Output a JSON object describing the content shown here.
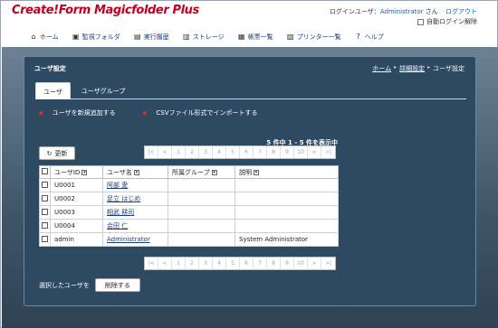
{
  "app": {
    "logo": "Create!Form Magicfolder Plus"
  },
  "login": {
    "label": "ログインユーザ：",
    "user": "Administrator",
    "suffix": "さん",
    "logout": "ログアウト",
    "auto_login": "自動ログイン解除"
  },
  "nav": [
    {
      "label": "ホーム",
      "icon": "home-icon"
    },
    {
      "label": "監視フォルダ",
      "icon": "folder-icon"
    },
    {
      "label": "実行履歴",
      "icon": "history-icon"
    },
    {
      "label": "ストレージ",
      "icon": "storage-icon"
    },
    {
      "label": "帳票一覧",
      "icon": "document-list-icon"
    },
    {
      "label": "プリンター一覧",
      "icon": "printer-icon"
    },
    {
      "label": "ヘルプ",
      "icon": "help-icon"
    }
  ],
  "panel": {
    "title": "ユーザ設定",
    "breadcrumb": [
      "ホーム",
      "詳細設定",
      "ユーザ設定"
    ]
  },
  "tabs": [
    "ユーザ",
    "ユーザグループ"
  ],
  "actions": [
    "ユーザを新規追加する",
    "CSVファイル形式でインポートする"
  ],
  "summary": "5 件中 1 - 5 件を表示中",
  "refresh_label": "更新",
  "pager": [
    "|<",
    "<",
    "1",
    "2",
    "3",
    "4",
    "5",
    "6",
    "7",
    "8",
    "9",
    "10",
    ">",
    ">|"
  ],
  "table": {
    "headers": [
      "ユーザID",
      "ユーザ名",
      "所属グループ",
      "説明"
    ],
    "rows": [
      {
        "id": "U0001",
        "name": "阿部 愛",
        "group": "",
        "desc": ""
      },
      {
        "id": "U0002",
        "name": "足立 はじめ",
        "group": "",
        "desc": ""
      },
      {
        "id": "U0003",
        "name": "相武 耕司",
        "group": "",
        "desc": ""
      },
      {
        "id": "U0004",
        "name": "会田 仁",
        "group": "",
        "desc": ""
      },
      {
        "id": "admin",
        "name": "Administrator",
        "group": "",
        "desc": "System Administrator"
      }
    ]
  },
  "bottom": {
    "label": "選択したユーザを",
    "delete": "削除する"
  }
}
